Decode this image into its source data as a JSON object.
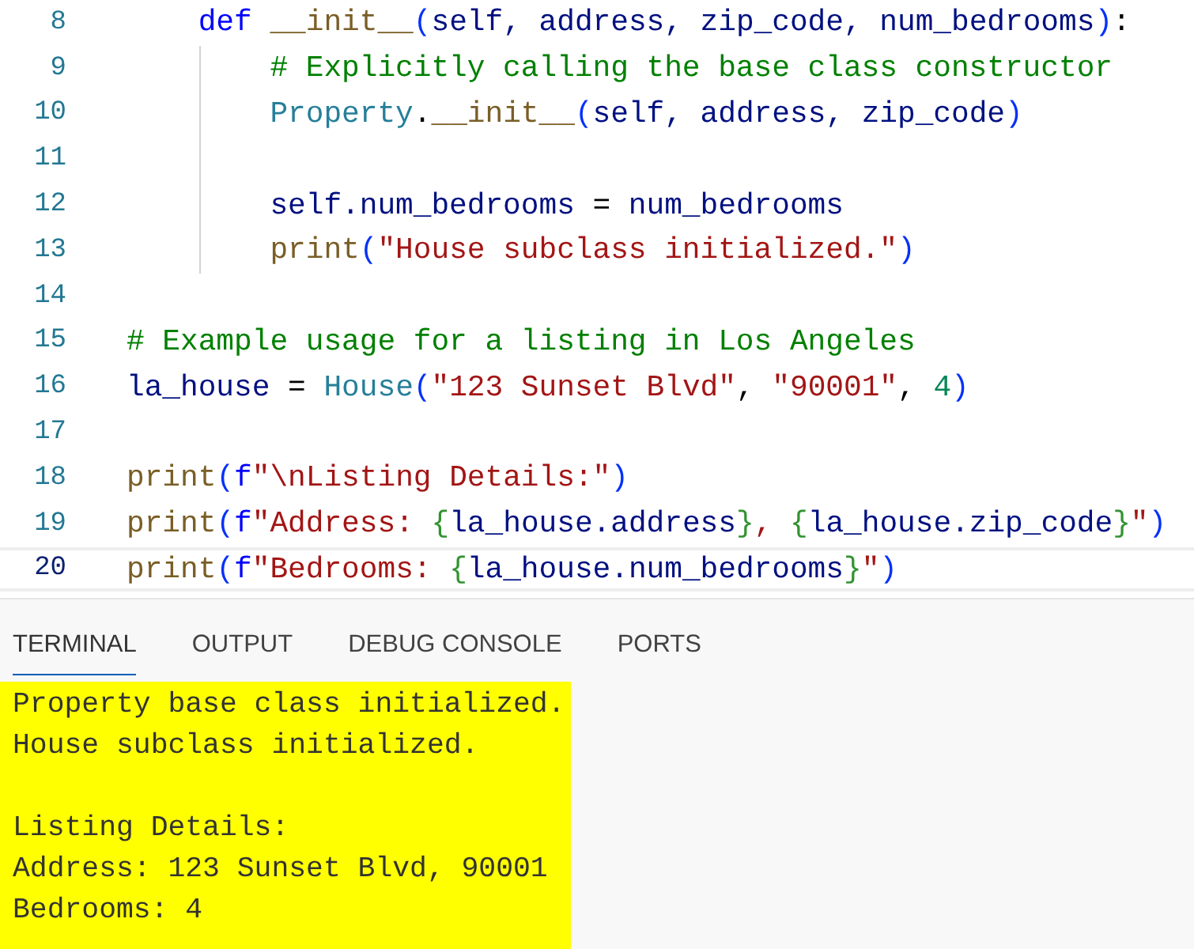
{
  "editor": {
    "lines": [
      {
        "number": "8",
        "active": false,
        "guide": false,
        "tokens": [
          {
            "kind": "kw",
            "text": "    def "
          },
          {
            "kind": "fn",
            "text": "__init__"
          },
          {
            "kind": "paren",
            "text": "("
          },
          {
            "kind": "var",
            "text": "self, address, zip_code, num_bedrooms"
          },
          {
            "kind": "paren",
            "text": ")"
          },
          {
            "kind": "plain",
            "text": ":"
          }
        ]
      },
      {
        "number": "9",
        "active": false,
        "guide": true,
        "tokens": [
          {
            "kind": "comment",
            "text": "        # Explicitly calling the base class constructor"
          }
        ]
      },
      {
        "number": "10",
        "active": false,
        "guide": true,
        "tokens": [
          {
            "kind": "cls",
            "text": "        Property"
          },
          {
            "kind": "plain",
            "text": "."
          },
          {
            "kind": "fn",
            "text": "__init__"
          },
          {
            "kind": "paren",
            "text": "("
          },
          {
            "kind": "var",
            "text": "self, address, zip_code"
          },
          {
            "kind": "paren",
            "text": ")"
          }
        ]
      },
      {
        "number": "11",
        "active": false,
        "guide": true
      },
      {
        "number": "12",
        "active": false,
        "guide": true,
        "tokens": [
          {
            "kind": "var",
            "text": "        self.num_bedrooms"
          },
          {
            "kind": "plain",
            "text": " = "
          },
          {
            "kind": "var",
            "text": "num_bedrooms"
          }
        ]
      },
      {
        "number": "13",
        "active": false,
        "guide": true,
        "tokens": [
          {
            "kind": "fn",
            "text": "        print"
          },
          {
            "kind": "paren",
            "text": "("
          },
          {
            "kind": "str",
            "text": "\"House subclass initialized.\""
          },
          {
            "kind": "paren",
            "text": ")"
          }
        ]
      },
      {
        "number": "14",
        "active": false,
        "guide": false
      },
      {
        "number": "15",
        "active": false,
        "guide": false,
        "tokens": [
          {
            "kind": "comment",
            "text": "# Example usage for a listing in Los Angeles"
          }
        ]
      },
      {
        "number": "16",
        "active": false,
        "guide": false,
        "tokens": [
          {
            "kind": "var",
            "text": "la_house"
          },
          {
            "kind": "plain",
            "text": " = "
          },
          {
            "kind": "cls",
            "text": "House"
          },
          {
            "kind": "paren",
            "text": "("
          },
          {
            "kind": "str",
            "text": "\"123 Sunset Blvd\""
          },
          {
            "kind": "plain",
            "text": ", "
          },
          {
            "kind": "str",
            "text": "\"90001\""
          },
          {
            "kind": "plain",
            "text": ", "
          },
          {
            "kind": "num",
            "text": "4"
          },
          {
            "kind": "paren",
            "text": ")"
          }
        ]
      },
      {
        "number": "17",
        "active": false,
        "guide": false
      },
      {
        "number": "18",
        "active": false,
        "guide": false,
        "tokens": [
          {
            "kind": "fn",
            "text": "print"
          },
          {
            "kind": "paren",
            "text": "("
          },
          {
            "kind": "kw",
            "text": "f"
          },
          {
            "kind": "str",
            "text": "\"\\nListing Details:\""
          },
          {
            "kind": "paren",
            "text": ")"
          }
        ]
      },
      {
        "number": "19",
        "active": false,
        "guide": false,
        "tokens": [
          {
            "kind": "fn",
            "text": "print"
          },
          {
            "kind": "paren",
            "text": "("
          },
          {
            "kind": "kw",
            "text": "f"
          },
          {
            "kind": "str",
            "text": "\"Address: "
          },
          {
            "kind": "brace",
            "text": "{"
          },
          {
            "kind": "var",
            "text": "la_house.address"
          },
          {
            "kind": "brace",
            "text": "}"
          },
          {
            "kind": "str",
            "text": ", "
          },
          {
            "kind": "brace",
            "text": "{"
          },
          {
            "kind": "var",
            "text": "la_house.zip_code"
          },
          {
            "kind": "brace",
            "text": "}"
          },
          {
            "kind": "str",
            "text": "\""
          },
          {
            "kind": "paren",
            "text": ")"
          }
        ]
      },
      {
        "number": "20",
        "active": true,
        "guide": false,
        "tokens": [
          {
            "kind": "fn",
            "text": "print"
          },
          {
            "kind": "paren",
            "text": "("
          },
          {
            "kind": "kw",
            "text": "f"
          },
          {
            "kind": "str",
            "text": "\"Bedrooms: "
          },
          {
            "kind": "brace",
            "text": "{"
          },
          {
            "kind": "var",
            "text": "la_house.num_bedrooms"
          },
          {
            "kind": "brace",
            "text": "}"
          },
          {
            "kind": "str",
            "text": "\""
          },
          {
            "kind": "paren",
            "text": ")"
          }
        ]
      }
    ]
  },
  "panel": {
    "tabs": [
      {
        "label": "TERMINAL",
        "selected": true
      },
      {
        "label": "OUTPUT",
        "selected": false
      },
      {
        "label": "DEBUG CONSOLE",
        "selected": false
      },
      {
        "label": "PORTS",
        "selected": false
      }
    ],
    "terminal": {
      "highlighted": true,
      "blocks": [
        {
          "lines": [
            "Property base class initialized.",
            "House subclass initialized."
          ]
        },
        {
          "lines": [
            "Listing Details:",
            "Address: 123 Sunset Blvd, 90001",
            "Bedrooms: 4"
          ]
        }
      ]
    }
  }
}
